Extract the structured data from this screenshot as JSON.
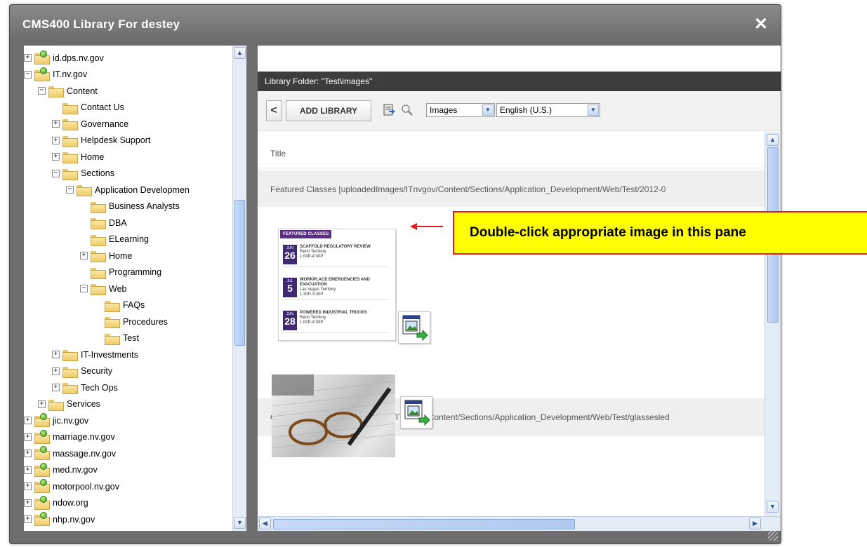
{
  "dialog": {
    "title": "CMS400 Library For destey",
    "close_icon": "close-icon",
    "close_glyph": "✕"
  },
  "tree": {
    "items": [
      {
        "label": "id.dps.nv.gov",
        "exp": "+",
        "type": "site"
      },
      {
        "label": "IT.nv.gov",
        "exp": "−",
        "type": "site"
      },
      {
        "label": "Content",
        "exp": "−",
        "type": "folder"
      },
      {
        "label": "Contact Us",
        "exp": "",
        "type": "folder"
      },
      {
        "label": "Governance",
        "exp": "+",
        "type": "folder"
      },
      {
        "label": "Helpdesk Support",
        "exp": "+",
        "type": "folder"
      },
      {
        "label": "Home",
        "exp": "+",
        "type": "folder"
      },
      {
        "label": "Sections",
        "exp": "−",
        "type": "folder"
      },
      {
        "label": "Application Developmen",
        "exp": "−",
        "type": "folder"
      },
      {
        "label": "Business Analysts",
        "exp": "",
        "type": "folder"
      },
      {
        "label": "DBA",
        "exp": "",
        "type": "folder"
      },
      {
        "label": "ELearning",
        "exp": "",
        "type": "folder"
      },
      {
        "label": "Home",
        "exp": "+",
        "type": "folder"
      },
      {
        "label": "Programming",
        "exp": "",
        "type": "folder"
      },
      {
        "label": "Web",
        "exp": "−",
        "type": "folder"
      },
      {
        "label": "FAQs",
        "exp": "",
        "type": "folder"
      },
      {
        "label": "Procedures",
        "exp": "",
        "type": "folder"
      },
      {
        "label": "Test",
        "exp": "",
        "type": "folder"
      },
      {
        "label": "IT-Investments",
        "exp": "+",
        "type": "folder"
      },
      {
        "label": "Security",
        "exp": "+",
        "type": "folder"
      },
      {
        "label": "Tech Ops",
        "exp": "+",
        "type": "folder"
      },
      {
        "label": "Services",
        "exp": "+",
        "type": "folder"
      },
      {
        "label": "jic.nv.gov",
        "exp": "+",
        "type": "site"
      },
      {
        "label": "marriage.nv.gov",
        "exp": "+",
        "type": "site"
      },
      {
        "label": "massage.nv.gov",
        "exp": "+",
        "type": "site"
      },
      {
        "label": "med.nv.gov",
        "exp": "+",
        "type": "site"
      },
      {
        "label": "motorpool.nv.gov",
        "exp": "+",
        "type": "site"
      },
      {
        "label": "ndow.org",
        "exp": "+",
        "type": "site"
      },
      {
        "label": "nhp.nv.gov",
        "exp": "+",
        "type": "site"
      }
    ]
  },
  "library": {
    "folder_label": "Library Folder: \"Test\\images\"",
    "back_glyph": "<",
    "add_library": "ADD LIBRARY",
    "type_select": "Images",
    "lang_select": "English (U.S.)",
    "column_title": "Title",
    "items": [
      {
        "title": "Featured Classes [uploadedImages/ITnvgov/Content/Sections/Application_Development/Web/Test/2012-0"
      },
      {
        "title": "Glasses Image [uploadedImages/ITnvgov/Content/Sections/Application_Development/Web/Test/glassesled"
      }
    ]
  },
  "featured": {
    "tag": "FEATURED CLASSES",
    "events": [
      {
        "mon": "JUN",
        "day": "26",
        "title": "SCAFFOLD REGULATORY REVIEW",
        "loc": "Reno Territory",
        "time": "1:00P-4:00P"
      },
      {
        "mon": "JUL",
        "day": "5",
        "title": "WORKPLACE EMERGENCIES AND EVACUATION",
        "loc": "Las Vegas Territory",
        "time": "1:30P-3:30P"
      },
      {
        "mon": "JUN",
        "day": "28",
        "title": "POWERED INDUSTRIAL TRUCKS",
        "loc": "Reno Territory",
        "time": "1:00P-4:00P"
      }
    ]
  },
  "callout": {
    "text": "Double-click appropriate image in this pane"
  },
  "colors": {
    "titlebar": "#7a7a7a",
    "header_bar": "#3d3d3d",
    "callout_bg": "#ffff00",
    "callout_border": "#e31b1b",
    "purple": "#3d2a73"
  }
}
